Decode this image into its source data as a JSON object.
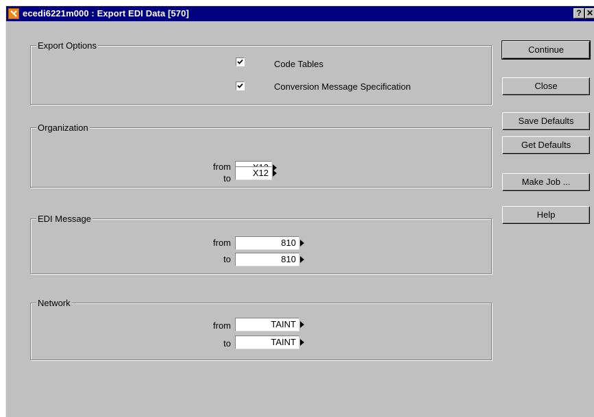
{
  "window": {
    "title": "ecedi6221m000 : Export EDI Data [570]",
    "help_button": "?",
    "close_button": "✕"
  },
  "export_options": {
    "label": "Export Options",
    "code_tables": {
      "label": "Code Tables",
      "checked": true
    },
    "conversion_spec": {
      "label": "Conversion Message Specification",
      "checked": true
    }
  },
  "organization": {
    "label": "Organization",
    "from_label": "from",
    "from_value": "X12",
    "to_label": "to",
    "to_value": "X12"
  },
  "edi_message": {
    "label": "EDI Message",
    "from_label": "from",
    "from_value": "810",
    "to_label": "to",
    "to_value": "810"
  },
  "network": {
    "label": "Network",
    "from_label": "from",
    "from_value": "TAINT",
    "to_label": "to",
    "to_value": "TAINT"
  },
  "buttons": {
    "continue": "Continue",
    "close": "Close",
    "save_defaults": "Save Defaults",
    "get_defaults": "Get Defaults",
    "make_job": "Make Job ...",
    "help": "Help"
  },
  "colors": {
    "titlebar": "#000080",
    "face": "#c0c0c0",
    "app_icon": "#e8871e"
  }
}
